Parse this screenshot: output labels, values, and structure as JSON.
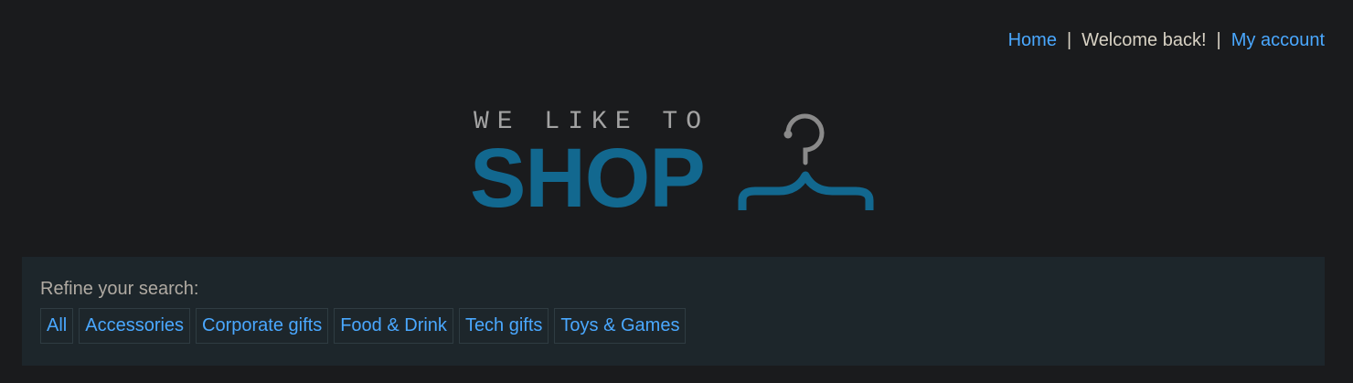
{
  "header": {
    "home_link": "Home",
    "separator": "|",
    "welcome_text": "Welcome back!",
    "account_link": "My account"
  },
  "logo": {
    "tagline": "WE LIKE TO",
    "wordmark": "SHOP",
    "icon": "hanger-icon"
  },
  "filters": {
    "label": "Refine your search:",
    "categories": [
      "All",
      "Accessories",
      "Corporate gifts",
      "Food & Drink",
      "Tech gifts",
      "Toys & Games"
    ]
  },
  "colors": {
    "background": "#1a1b1d",
    "link": "#4aa8ff",
    "brand": "#12688f",
    "panel": "#1d262b"
  }
}
